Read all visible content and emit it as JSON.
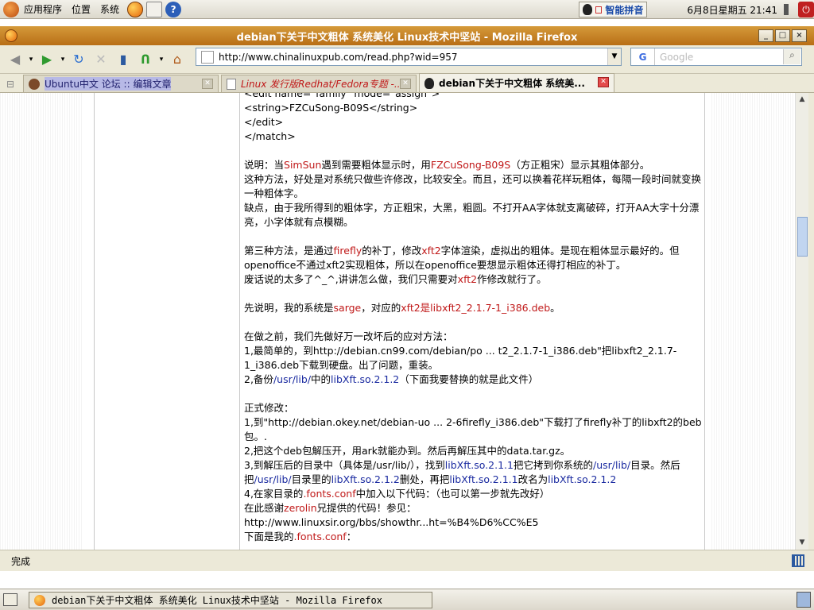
{
  "top_panel": {
    "menus": [
      "应用程序",
      "位置",
      "系统"
    ],
    "ime": "智能拼音",
    "datetime": "6月8日星期五  21:41"
  },
  "window": {
    "title": "debian下关于中文粗体 系统美化 Linux技术中坚站 - Mozilla Firefox",
    "buttons": [
      "_",
      "□",
      "×"
    ]
  },
  "nav": {
    "url": "http://www.chinalinuxpub.com/read.php?wid=957",
    "search_placeholder": "Google",
    "search_engine": "G"
  },
  "tabs": [
    {
      "label": "Ubuntu中文 论坛 :: 编辑文章",
      "active": false
    },
    {
      "label": "Linux 发行版Redhat/Fedora专题 -...",
      "active": false
    },
    {
      "label": "debian下关于中文粗体 系统美...",
      "active": true
    }
  ],
  "article": {
    "code": [
      "<edit name=\"family\" mode=\"assign\">",
      "<string>FZCuSong-B09S</string>",
      "</edit>",
      "</match>"
    ],
    "p1": {
      "a": "说明：当",
      "b": "SimSun",
      "c": "遇到需要粗体显示时，用",
      "d": "FZCuSong-B09S",
      "e": "（方正粗宋）显示其粗体部分。"
    },
    "p2": "这种方法，好处是对系统只做些许修改，比较安全。而且，还可以换着花样玩粗体，每隔一段时间就变换一种粗体字。",
    "p3": "缺点，由于我所得到的粗体字，方正粗宋，大黑，粗圆。不打开AA字体就支离破碎，打开AA大字十分漂亮，小字体就有点模糊。",
    "p4": {
      "a": "第三种方法，是通过",
      "b": "firefly",
      "c": "的补丁，修改",
      "d": "xft2",
      "e": "字体渲染，虚拟出的粗体。是现在粗体显示最好的。但"
    },
    "p5": "openoffice不通过xft2实现粗体，所以在openoffice要想显示粗体还得打相应的补丁。",
    "p6": {
      "a": "废话说的太多了^_^,讲讲怎么做，我们只需要对",
      "b": "xft2",
      "c": "作修改就行了。"
    },
    "p7": {
      "a": "先说明，我的系统是",
      "b": "sarge",
      "c": "，对应的",
      "d": "xft2是libxft2_2.1.7-1_i386.deb",
      "e": "。"
    },
    "p8": "在做之前，我们先做好万一改坏后的应对方法：",
    "p9": "1,最简单的，到http://debian.cn99.com/debian/po ... t2_2.1.7-1_i386.deb\"把libxft2_2.1.7-1_i386.deb下载到硬盘。出了问题，重装。",
    "p10": {
      "a": "2,备份",
      "b": "/usr/lib/",
      "c": "中的",
      "d": "libXft.so.2.1.2",
      "e": "（下面我要替换的就是此文件）"
    },
    "p11": "正式修改：",
    "p12": "1,到\"http://debian.okey.net/debian-uo ... 2-6firefly_i386.deb\"下载打了firefly补丁的libxft2的beb包。.",
    "p13": "2,把这个deb包解压开，用ark就能办到。然后再解压其中的data.tar.gz。",
    "p14": {
      "a": "3,到解压后的目录中（具体是/usr/lib/），找到",
      "b": "libXft.so.2.1.1",
      "c": "把它拷到你系统的",
      "d": "/usr/lib/",
      "e": "目录。然后把",
      "f": "/usr/lib/",
      "g": "目录里的",
      "h": "libXft.so.2.1.2",
      "i": "删处，再把",
      "j": "libXft.so.2.1.1",
      "k": "改名为",
      "l": "libXft.so.2.1.2"
    },
    "p15": {
      "a": "4,在家目录的",
      "b": ".fonts.conf",
      "c": "中加入以下代码：（也可以第一步就先改好）"
    },
    "p16": {
      "a": "在此感谢",
      "b": "zerolin",
      "c": "兄提供的代码！参见："
    },
    "p17": "http://www.linuxsir.org/bbs/showthr...ht=%B4%D6%CC%E5",
    "p18": {
      "a": "下面是我的",
      "b": ".fonts.conf",
      "c": "："
    }
  },
  "status": "完成",
  "taskbar": {
    "item": "debian下关于中文粗体 系统美化 Linux技术中坚站 - Mozilla Firefox"
  }
}
